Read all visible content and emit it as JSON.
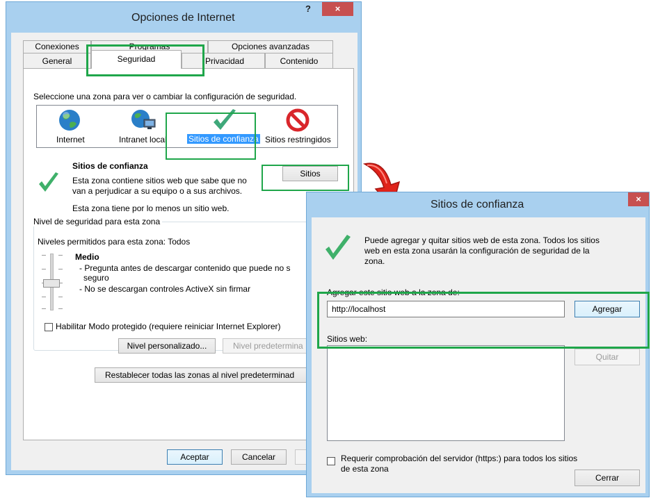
{
  "main_dialog": {
    "title": "Opciones de Internet",
    "help_glyph": "?",
    "close_glyph": "×",
    "tabs_row1": [
      "Conexiones",
      "Programas",
      "Opciones avanzadas"
    ],
    "tabs_row2": [
      "General",
      "Seguridad",
      "Privacidad",
      "Contenido"
    ],
    "zone_prompt": "Seleccione una zona para ver o cambiar la configuración de seguridad.",
    "zones": [
      {
        "label": "Internet",
        "icon": "globe-icon"
      },
      {
        "label": "Intranet local",
        "icon": "intranet-icon"
      },
      {
        "label": "Sitios de confianza",
        "icon": "check-icon"
      },
      {
        "label": "Sitios restringidos",
        "icon": "restricted-icon"
      }
    ],
    "zone_title": "Sitios de confianza",
    "zone_desc_line1": "Esta zona contiene sitios web que sabe que no",
    "zone_desc_line2": "van a perjudicar a su equipo o a sus archivos.",
    "zone_site_count": "Esta zona tiene por lo menos un sitio web.",
    "sites_button": "Sitios",
    "security_level_group": "Nivel de seguridad para esta zona",
    "allowed_levels": "Niveles permitidos para esta zona: Todos",
    "level_name": "Medio",
    "level_desc_1": "- Pregunta antes de descargar contenido que puede no s",
    "level_desc_2": "seguro",
    "level_desc_3": "- No se descargan controles ActiveX sin firmar",
    "protected_mode": "Habilitar Modo protegido (requiere reiniciar Internet Explorer)",
    "custom_level_button": "Nivel personalizado...",
    "default_level_button": "Nivel predetermina",
    "reset_all_button": "Restablecer todas las zonas al nivel predeterminad",
    "ok_button": "Aceptar",
    "cancel_button": "Cancelar"
  },
  "trusted_dialog": {
    "title": "Sitios de confianza",
    "close_glyph": "×",
    "info_line1": "Puede agregar y quitar sitios web de esta zona. Todos los sitios",
    "info_line2": "web en esta zona usarán la configuración de seguridad de la",
    "info_line3": "zona.",
    "add_label": "Agregar este sitio web a la zona de:",
    "url_value": "http://localhost",
    "add_button": "Agregar",
    "websites_label": "Sitios web:",
    "remove_button": "Quitar",
    "https_line1": "Requerir comprobación del servidor (https:) para todos los sitios",
    "https_line2": "de esta zona",
    "close_button": "Cerrar"
  },
  "colors": {
    "highlight_green": "#1fa64a",
    "arrow_red": "#e0231a",
    "close_red": "#c75050",
    "selection_blue": "#3399ff"
  }
}
